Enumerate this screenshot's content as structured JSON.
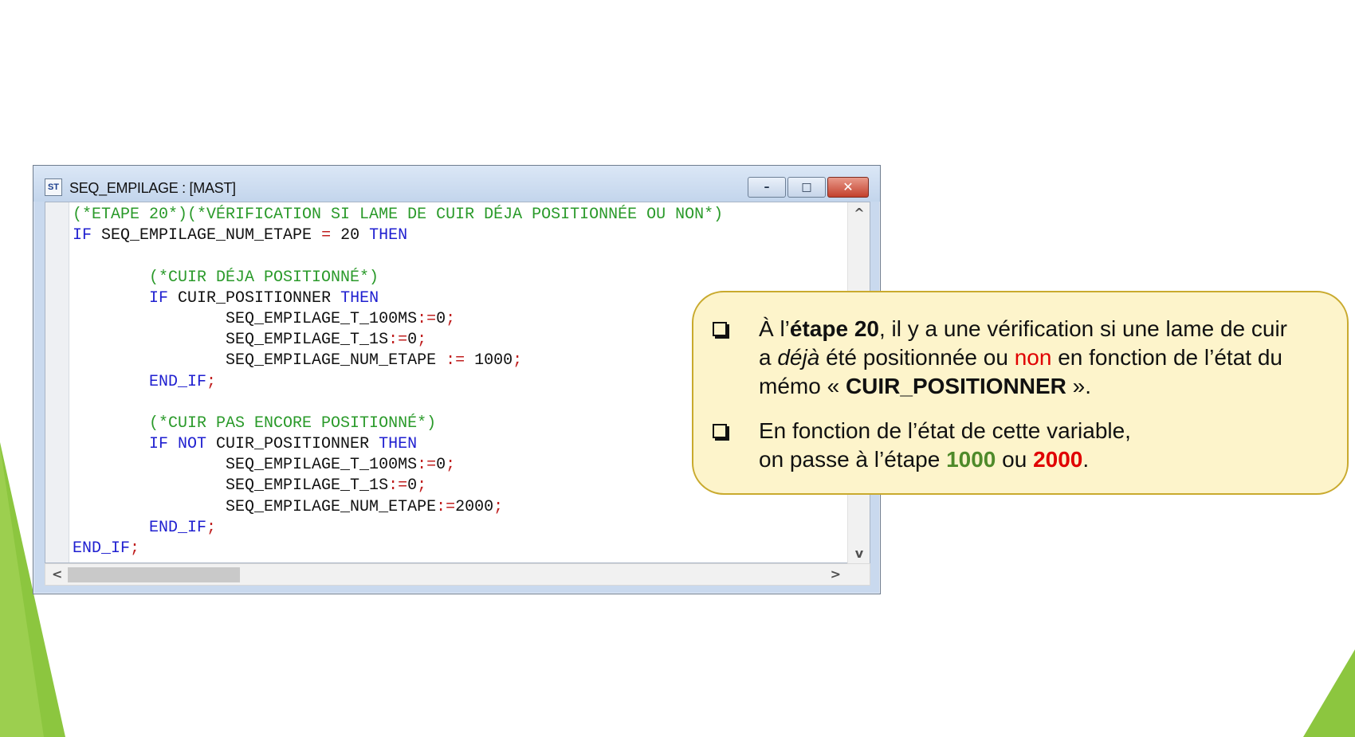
{
  "window": {
    "title": "SEQ_EMPILAGE : [MAST]",
    "icon_label": "ST",
    "buttons": {
      "minimize": "–",
      "maximize": "□",
      "close": "✕"
    }
  },
  "code": {
    "lines": [
      [
        {
          "t": "(*ETAPE 20*)(*VÉRIFICATION SI LAME DE CUIR DÉJA POSITIONNÉE OU NON*)",
          "c": "cm"
        }
      ],
      [
        {
          "t": "IF",
          "c": "kw"
        },
        {
          "t": " SEQ_EMPILAGE_NUM_ETAPE ",
          "c": ""
        },
        {
          "t": "=",
          "c": "op"
        },
        {
          "t": " 20 ",
          "c": ""
        },
        {
          "t": "THEN",
          "c": "kw"
        }
      ],
      [],
      [
        {
          "t": "        ",
          "c": ""
        },
        {
          "t": "(*CUIR DÉJA POSITIONNÉ*)",
          "c": "cm"
        }
      ],
      [
        {
          "t": "        ",
          "c": ""
        },
        {
          "t": "IF",
          "c": "kw"
        },
        {
          "t": " CUIR_POSITIONNER ",
          "c": ""
        },
        {
          "t": "THEN",
          "c": "kw"
        }
      ],
      [
        {
          "t": "                SEQ_EMPILAGE_T_100MS",
          "c": ""
        },
        {
          "t": ":=",
          "c": "op"
        },
        {
          "t": "0",
          "c": ""
        },
        {
          "t": ";",
          "c": "op"
        }
      ],
      [
        {
          "t": "                SEQ_EMPILAGE_T_1S",
          "c": ""
        },
        {
          "t": ":=",
          "c": "op"
        },
        {
          "t": "0",
          "c": ""
        },
        {
          "t": ";",
          "c": "op"
        }
      ],
      [
        {
          "t": "                SEQ_EMPILAGE_NUM_ETAPE ",
          "c": ""
        },
        {
          "t": ":=",
          "c": "op"
        },
        {
          "t": " 1000",
          "c": ""
        },
        {
          "t": ";",
          "c": "op"
        }
      ],
      [
        {
          "t": "        ",
          "c": ""
        },
        {
          "t": "END_IF",
          "c": "kw"
        },
        {
          "t": ";",
          "c": "op"
        }
      ],
      [],
      [
        {
          "t": "        ",
          "c": ""
        },
        {
          "t": "(*CUIR PAS ENCORE POSITIONNÉ*)",
          "c": "cm"
        }
      ],
      [
        {
          "t": "        ",
          "c": ""
        },
        {
          "t": "IF NOT",
          "c": "kw"
        },
        {
          "t": " CUIR_POSITIONNER ",
          "c": ""
        },
        {
          "t": "THEN",
          "c": "kw"
        }
      ],
      [
        {
          "t": "                SEQ_EMPILAGE_T_100MS",
          "c": ""
        },
        {
          "t": ":=",
          "c": "op"
        },
        {
          "t": "0",
          "c": ""
        },
        {
          "t": ";",
          "c": "op"
        }
      ],
      [
        {
          "t": "                SEQ_EMPILAGE_T_1S",
          "c": ""
        },
        {
          "t": ":=",
          "c": "op"
        },
        {
          "t": "0",
          "c": ""
        },
        {
          "t": ";",
          "c": "op"
        }
      ],
      [
        {
          "t": "                SEQ_EMPILAGE_NUM_ETAPE",
          "c": ""
        },
        {
          "t": ":=",
          "c": "op"
        },
        {
          "t": "2000",
          "c": ""
        },
        {
          "t": ";",
          "c": "op"
        }
      ],
      [
        {
          "t": "        ",
          "c": ""
        },
        {
          "t": "END_IF",
          "c": "kw"
        },
        {
          "t": ";",
          "c": "op"
        }
      ],
      [
        {
          "t": "END_IF",
          "c": "kw"
        },
        {
          "t": ";",
          "c": "op"
        }
      ]
    ]
  },
  "scrollbars": {
    "up": "^",
    "down": "v",
    "left": "<",
    "right": ">"
  },
  "callout": {
    "bullet1": {
      "l1a": "À l’",
      "l1b": "étape 20",
      "l1c": ", il y a une vérification si une lame de cuir",
      "l2a": "a ",
      "l2b": "déjà",
      "l2c": " été positionnée ou ",
      "l2d": "non",
      "l2e": " en fonction de l’état du",
      "l3a": "mémo « ",
      "l3b": "CUIR_POSITIONNER",
      "l3c": " »."
    },
    "bullet2": {
      "l1": "En fonction de l’état de cette variable,",
      "l2a": "on passe à l’étape ",
      "l2b": "1000",
      "l2c": " ou ",
      "l2d": "2000",
      "l2e": "."
    }
  },
  "colors": {
    "keyword": "#1f1fd0",
    "comment": "#2a9a2a",
    "operator": "#c02020",
    "accent_green": "#8cc63f"
  }
}
